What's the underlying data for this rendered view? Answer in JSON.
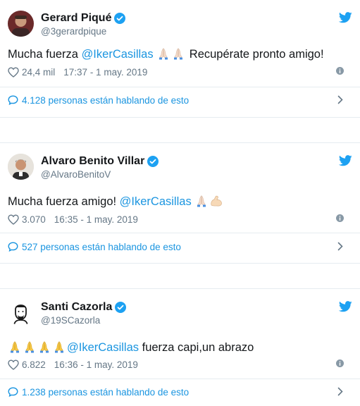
{
  "colors": {
    "link": "#1b95e0",
    "text": "#14171a",
    "muted": "#657786",
    "verified": "#1da1f2"
  },
  "tweets": [
    {
      "name": "Gerard Piqué",
      "handle": "@3gerardpique",
      "text_before": "Mucha fuerza ",
      "mention": "@IkerCasillas",
      "text_after": " Recupérate pronto amigo!",
      "emojis": [
        "folded-hands",
        "folded-hands"
      ],
      "likes": "24,4 mil",
      "timestamp": "17:37 - 1 may. 2019",
      "talking": "4.128 personas están hablando de esto"
    },
    {
      "name": "Alvaro Benito Villar",
      "handle": "@AlvaroBenitoV",
      "text_before": "Mucha fuerza amigo! ",
      "mention": "@IkerCasillas",
      "text_after": "",
      "emojis": [
        "folded-hands",
        "flexed-biceps"
      ],
      "likes": "3.070",
      "timestamp": "16:35 - 1 may. 2019",
      "talking": "527 personas están hablando de esto"
    },
    {
      "name": "Santi Cazorla",
      "handle": "@19SCazorla",
      "text_before": "",
      "mention": "@IkerCasillas",
      "text_after": " fuerza capi,un abrazo",
      "emojis": [
        "folded-hands",
        "folded-hands",
        "folded-hands",
        "folded-hands"
      ],
      "likes": "6.822",
      "timestamp": "16:36 - 1 may. 2019",
      "talking": "1.238 personas están hablando de esto"
    }
  ]
}
